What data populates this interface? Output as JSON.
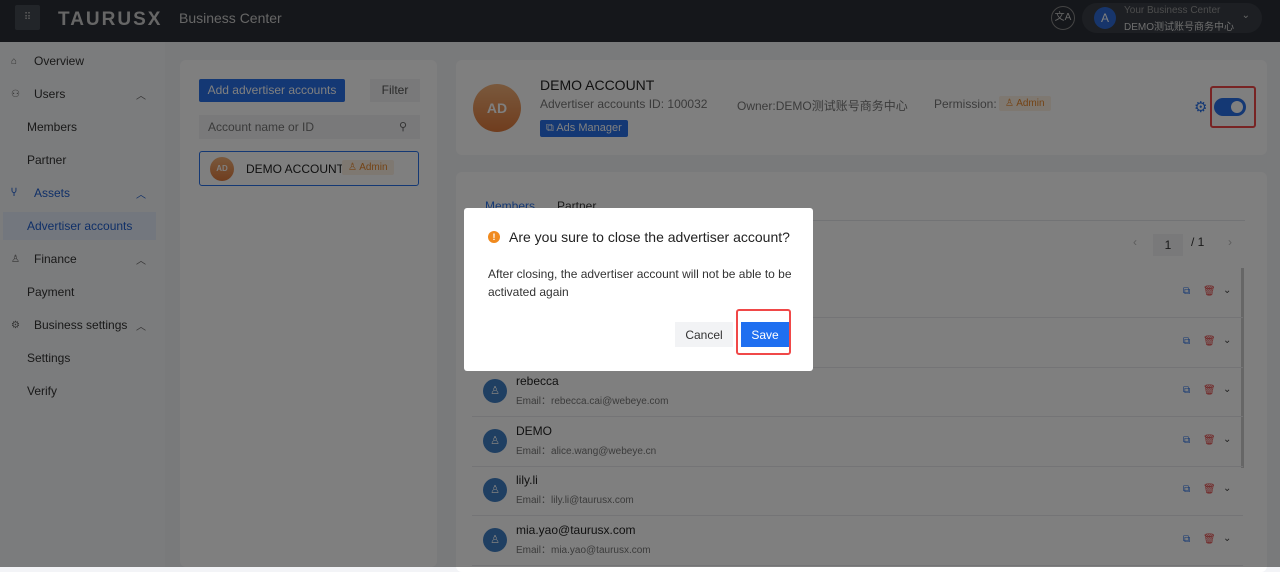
{
  "header": {
    "logo": "TAURUSX",
    "app_name": "Business Center",
    "business_label": "Your Business Center",
    "business_name": "DEMO测试账号商务中心",
    "avatar_letter": "A"
  },
  "sidebar": {
    "items": [
      {
        "label": "Overview",
        "icon": "home-icon",
        "type": "item"
      },
      {
        "label": "Users",
        "icon": "users-icon",
        "type": "group"
      },
      {
        "label": "Members",
        "type": "sub"
      },
      {
        "label": "Partner",
        "type": "sub"
      },
      {
        "label": "Assets",
        "icon": "assets-icon",
        "type": "group"
      },
      {
        "label": "Advertiser accounts",
        "type": "sub",
        "active": true
      },
      {
        "label": "Finance",
        "icon": "finance-icon",
        "type": "group"
      },
      {
        "label": "Payment",
        "type": "sub"
      },
      {
        "label": "Business settings",
        "icon": "settings-icon",
        "type": "group"
      },
      {
        "label": "Settings",
        "type": "sub"
      },
      {
        "label": "Verify",
        "type": "sub"
      }
    ]
  },
  "accounts_panel": {
    "add_label": "Add advertiser accounts",
    "filter_label": "Filter",
    "search_placeholder": "Account name or ID",
    "accounts": [
      {
        "name": "DEMO ACCOUNT",
        "role": "Admin"
      }
    ]
  },
  "account_detail": {
    "name": "DEMO ACCOUNT",
    "id_label": "Advertiser accounts ID:",
    "id": "100032",
    "owner_label": "Owner:",
    "owner": "DEMO测试账号商务中心",
    "permission_label": "Permission:",
    "permission": "Admin",
    "ads_manager_label": "Ads Manager",
    "enabled": true
  },
  "members": {
    "tabs": [
      "Members",
      "Partner"
    ],
    "page": "1",
    "total_pages": "/ 1",
    "rows": [
      {
        "name": "",
        "email": ""
      },
      {
        "name": "",
        "email": ""
      },
      {
        "name": "rebecca",
        "email": "Email：rebecca.cai@webeye.com"
      },
      {
        "name": "DEMO",
        "email": "Email：alice.wang@webeye.cn"
      },
      {
        "name": "lily.li",
        "email": "Email：lily.li@taurusx.com"
      },
      {
        "name": "mia.yao@taurusx.com",
        "email": "Email：mia.yao@taurusx.com"
      }
    ]
  },
  "dialog": {
    "title": "Are you sure to close the advertiser account?",
    "body": "After closing, the advertiser account will not be able to be activated again",
    "cancel_label": "Cancel",
    "save_label": "Save"
  },
  "colors": {
    "primary": "#2870e8",
    "warning": "#f08a1e",
    "highlight": "#f04848"
  }
}
